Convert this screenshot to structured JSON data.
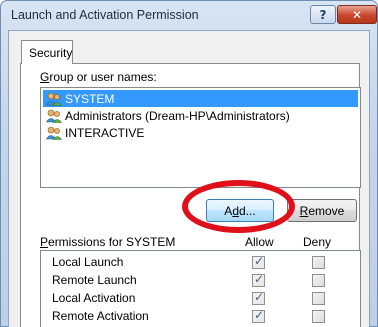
{
  "window": {
    "title": "Launch and Activation Permission"
  },
  "titlebar": {
    "help_glyph": "?",
    "close_glyph": "✕"
  },
  "tabs": [
    {
      "label": "Security"
    }
  ],
  "group_box": {
    "label_prefix": "G",
    "label_rest": "roup or user names:",
    "items": [
      {
        "label": "SYSTEM",
        "selected": true,
        "icon": "users-group-icon"
      },
      {
        "label": "Administrators (Dream-HP\\Administrators)",
        "selected": false,
        "icon": "users-group-icon"
      },
      {
        "label": "INTERACTIVE",
        "selected": false,
        "icon": "users-group-icon"
      }
    ]
  },
  "buttons": {
    "add": {
      "label_pre": "A",
      "label_key": "d",
      "label_post": "d..."
    },
    "remove": {
      "label_key": "R",
      "label_rest": "emove"
    }
  },
  "permissions": {
    "header_key": "P",
    "header_rest": "ermissions for SYSTEM",
    "allow_label": "Allow",
    "deny_label": "Deny",
    "rows": [
      {
        "label": "Local Launch",
        "allow": true,
        "deny": false
      },
      {
        "label": "Remote Launch",
        "allow": true,
        "deny": false
      },
      {
        "label": "Local Activation",
        "allow": true,
        "deny": false
      },
      {
        "label": "Remote Activation",
        "allow": true,
        "deny": false
      }
    ]
  },
  "annotation": {
    "color": "#e0101a"
  }
}
